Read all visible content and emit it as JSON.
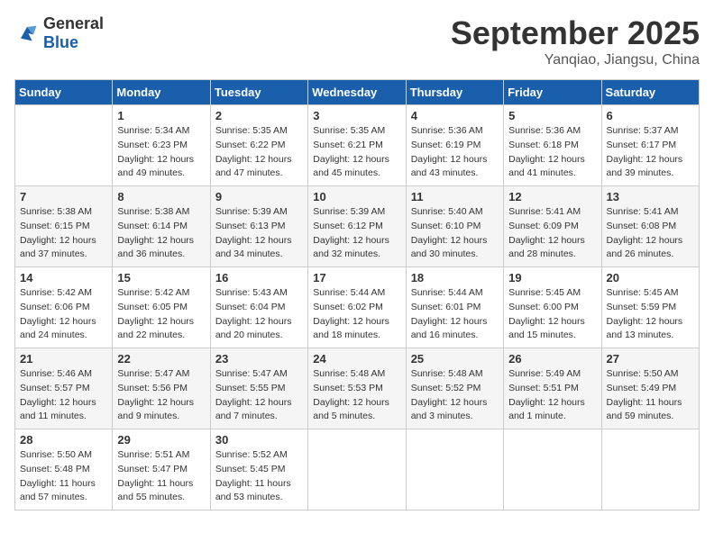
{
  "logo": {
    "line1": "General",
    "line2": "Blue"
  },
  "title": "September 2025",
  "location": "Yanqiao, Jiangsu, China",
  "headers": [
    "Sunday",
    "Monday",
    "Tuesday",
    "Wednesday",
    "Thursday",
    "Friday",
    "Saturday"
  ],
  "weeks": [
    [
      {
        "day": "",
        "info": ""
      },
      {
        "day": "1",
        "info": "Sunrise: 5:34 AM\nSunset: 6:23 PM\nDaylight: 12 hours\nand 49 minutes."
      },
      {
        "day": "2",
        "info": "Sunrise: 5:35 AM\nSunset: 6:22 PM\nDaylight: 12 hours\nand 47 minutes."
      },
      {
        "day": "3",
        "info": "Sunrise: 5:35 AM\nSunset: 6:21 PM\nDaylight: 12 hours\nand 45 minutes."
      },
      {
        "day": "4",
        "info": "Sunrise: 5:36 AM\nSunset: 6:19 PM\nDaylight: 12 hours\nand 43 minutes."
      },
      {
        "day": "5",
        "info": "Sunrise: 5:36 AM\nSunset: 6:18 PM\nDaylight: 12 hours\nand 41 minutes."
      },
      {
        "day": "6",
        "info": "Sunrise: 5:37 AM\nSunset: 6:17 PM\nDaylight: 12 hours\nand 39 minutes."
      }
    ],
    [
      {
        "day": "7",
        "info": "Sunrise: 5:38 AM\nSunset: 6:15 PM\nDaylight: 12 hours\nand 37 minutes."
      },
      {
        "day": "8",
        "info": "Sunrise: 5:38 AM\nSunset: 6:14 PM\nDaylight: 12 hours\nand 36 minutes."
      },
      {
        "day": "9",
        "info": "Sunrise: 5:39 AM\nSunset: 6:13 PM\nDaylight: 12 hours\nand 34 minutes."
      },
      {
        "day": "10",
        "info": "Sunrise: 5:39 AM\nSunset: 6:12 PM\nDaylight: 12 hours\nand 32 minutes."
      },
      {
        "day": "11",
        "info": "Sunrise: 5:40 AM\nSunset: 6:10 PM\nDaylight: 12 hours\nand 30 minutes."
      },
      {
        "day": "12",
        "info": "Sunrise: 5:41 AM\nSunset: 6:09 PM\nDaylight: 12 hours\nand 28 minutes."
      },
      {
        "day": "13",
        "info": "Sunrise: 5:41 AM\nSunset: 6:08 PM\nDaylight: 12 hours\nand 26 minutes."
      }
    ],
    [
      {
        "day": "14",
        "info": "Sunrise: 5:42 AM\nSunset: 6:06 PM\nDaylight: 12 hours\nand 24 minutes."
      },
      {
        "day": "15",
        "info": "Sunrise: 5:42 AM\nSunset: 6:05 PM\nDaylight: 12 hours\nand 22 minutes."
      },
      {
        "day": "16",
        "info": "Sunrise: 5:43 AM\nSunset: 6:04 PM\nDaylight: 12 hours\nand 20 minutes."
      },
      {
        "day": "17",
        "info": "Sunrise: 5:44 AM\nSunset: 6:02 PM\nDaylight: 12 hours\nand 18 minutes."
      },
      {
        "day": "18",
        "info": "Sunrise: 5:44 AM\nSunset: 6:01 PM\nDaylight: 12 hours\nand 16 minutes."
      },
      {
        "day": "19",
        "info": "Sunrise: 5:45 AM\nSunset: 6:00 PM\nDaylight: 12 hours\nand 15 minutes."
      },
      {
        "day": "20",
        "info": "Sunrise: 5:45 AM\nSunset: 5:59 PM\nDaylight: 12 hours\nand 13 minutes."
      }
    ],
    [
      {
        "day": "21",
        "info": "Sunrise: 5:46 AM\nSunset: 5:57 PM\nDaylight: 12 hours\nand 11 minutes."
      },
      {
        "day": "22",
        "info": "Sunrise: 5:47 AM\nSunset: 5:56 PM\nDaylight: 12 hours\nand 9 minutes."
      },
      {
        "day": "23",
        "info": "Sunrise: 5:47 AM\nSunset: 5:55 PM\nDaylight: 12 hours\nand 7 minutes."
      },
      {
        "day": "24",
        "info": "Sunrise: 5:48 AM\nSunset: 5:53 PM\nDaylight: 12 hours\nand 5 minutes."
      },
      {
        "day": "25",
        "info": "Sunrise: 5:48 AM\nSunset: 5:52 PM\nDaylight: 12 hours\nand 3 minutes."
      },
      {
        "day": "26",
        "info": "Sunrise: 5:49 AM\nSunset: 5:51 PM\nDaylight: 12 hours\nand 1 minute."
      },
      {
        "day": "27",
        "info": "Sunrise: 5:50 AM\nSunset: 5:49 PM\nDaylight: 11 hours\nand 59 minutes."
      }
    ],
    [
      {
        "day": "28",
        "info": "Sunrise: 5:50 AM\nSunset: 5:48 PM\nDaylight: 11 hours\nand 57 minutes."
      },
      {
        "day": "29",
        "info": "Sunrise: 5:51 AM\nSunset: 5:47 PM\nDaylight: 11 hours\nand 55 minutes."
      },
      {
        "day": "30",
        "info": "Sunrise: 5:52 AM\nSunset: 5:45 PM\nDaylight: 11 hours\nand 53 minutes."
      },
      {
        "day": "",
        "info": ""
      },
      {
        "day": "",
        "info": ""
      },
      {
        "day": "",
        "info": ""
      },
      {
        "day": "",
        "info": ""
      }
    ]
  ]
}
